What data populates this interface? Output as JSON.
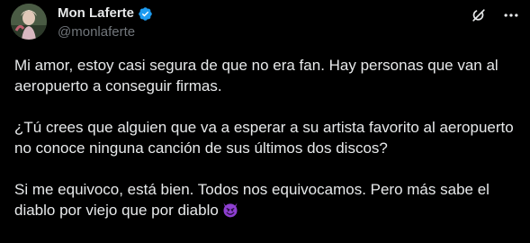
{
  "author": {
    "display_name": "Mon Laferte",
    "handle": "@monlaferte",
    "verified": true
  },
  "tweet": {
    "paragraphs": [
      "Mi amor, estoy casi segura de que no era fan. Hay personas que van al aeropuerto a conseguir firmas.",
      "¿Tú crees que alguien que va a esperar a su artista favorito al aeropuerto no conoce ninguna canción de sus últimos dos discos?",
      "Si me equivoco, está bien. Todos nos equivocamos. Pero más sabe el diablo por viejo que por diablo"
    ],
    "trailing_emoji": "smiling-face-with-horns"
  },
  "icons": {
    "verified": "verified-badge-icon",
    "grok": "grok-icon",
    "more": "more-options-icon"
  },
  "colors": {
    "background": "#000000",
    "text_primary": "#e7e9ea",
    "text_secondary": "#71767b",
    "verified_blue": "#1d9bf0",
    "emoji_purple": "#8e3fd0"
  }
}
